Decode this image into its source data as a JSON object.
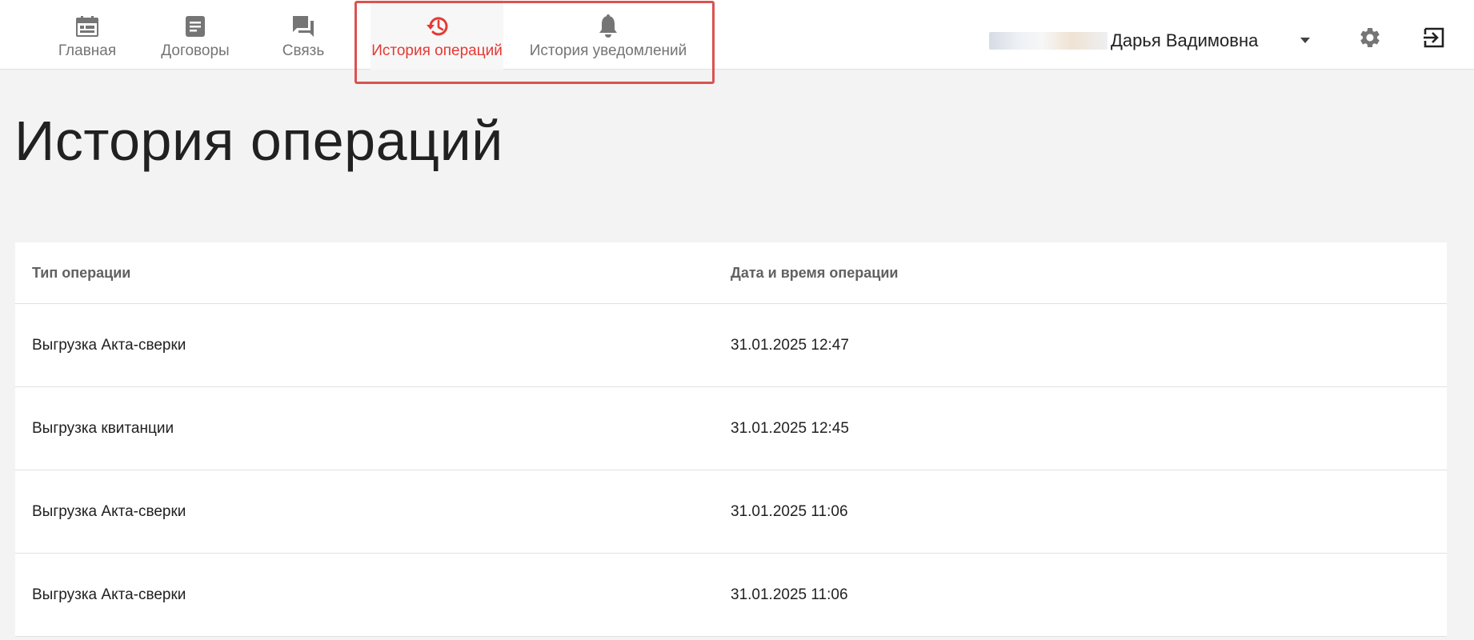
{
  "nav": {
    "items": [
      {
        "label": "Главная",
        "icon": "calendar-icon"
      },
      {
        "label": "Договоры",
        "icon": "document-icon"
      },
      {
        "label": "Связь",
        "icon": "chat-icon"
      },
      {
        "label": "История операций",
        "icon": "history-icon",
        "active": true
      },
      {
        "label": "История уведомлений",
        "icon": "bell-icon"
      }
    ]
  },
  "user": {
    "name": "Дарья Вадимовна"
  },
  "colors": {
    "accent": "#e53935",
    "highlight_border": "#d9534f",
    "nav_icon": "#757575",
    "background": "#f3f3f3"
  },
  "page": {
    "title": "История операций"
  },
  "table": {
    "columns": [
      "Тип операции",
      "Дата и время операции"
    ],
    "rows": [
      [
        "Выгрузка Акта-сверки",
        "31.01.2025 12:47"
      ],
      [
        "Выгрузка квитанции",
        "31.01.2025 12:45"
      ],
      [
        "Выгрузка Акта-сверки",
        "31.01.2025 11:06"
      ],
      [
        "Выгрузка Акта-сверки",
        "31.01.2025 11:06"
      ]
    ]
  }
}
